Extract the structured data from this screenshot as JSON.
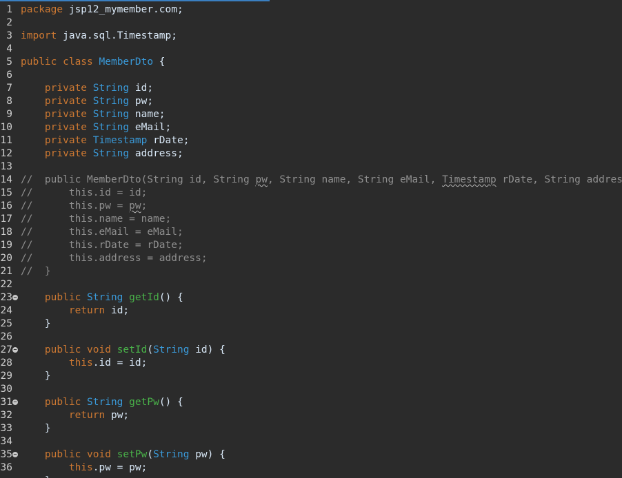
{
  "editor": {
    "colors": {
      "background": "#2b2b2b",
      "keyword": "#cc7832",
      "type": "#3a9ad9",
      "method": "#49b249",
      "plain": "#d9e8f7",
      "comment": "#8f8f8f",
      "accent": "#3a7fc1"
    },
    "fold_icon": "minus-circle-icon",
    "lines": [
      {
        "num": "1",
        "parts": [
          {
            "k": "kw",
            "t": "package"
          },
          {
            "k": "plain",
            "t": " jsp12_mymember.com;"
          }
        ]
      },
      {
        "num": "2",
        "parts": []
      },
      {
        "num": "3",
        "parts": [
          {
            "k": "kw",
            "t": "import"
          },
          {
            "k": "plain",
            "t": " java.sql.Timestamp;"
          }
        ]
      },
      {
        "num": "4",
        "parts": []
      },
      {
        "num": "5",
        "parts": [
          {
            "k": "kw",
            "t": "public class "
          },
          {
            "k": "ty",
            "t": "MemberDto"
          },
          {
            "k": "plain",
            "t": " {"
          }
        ]
      },
      {
        "num": "6",
        "parts": []
      },
      {
        "num": "7",
        "parts": [
          {
            "k": "plain",
            "t": "    "
          },
          {
            "k": "kw",
            "t": "private "
          },
          {
            "k": "ty",
            "t": "String"
          },
          {
            "k": "plain",
            "t": " id;"
          }
        ]
      },
      {
        "num": "8",
        "parts": [
          {
            "k": "plain",
            "t": "    "
          },
          {
            "k": "kw",
            "t": "private "
          },
          {
            "k": "ty",
            "t": "String"
          },
          {
            "k": "plain",
            "t": " pw;"
          }
        ]
      },
      {
        "num": "9",
        "parts": [
          {
            "k": "plain",
            "t": "    "
          },
          {
            "k": "kw",
            "t": "private "
          },
          {
            "k": "ty",
            "t": "String"
          },
          {
            "k": "plain",
            "t": " name;"
          }
        ]
      },
      {
        "num": "10",
        "parts": [
          {
            "k": "plain",
            "t": "    "
          },
          {
            "k": "kw",
            "t": "private "
          },
          {
            "k": "ty",
            "t": "String"
          },
          {
            "k": "plain",
            "t": " eMail;"
          }
        ]
      },
      {
        "num": "11",
        "parts": [
          {
            "k": "plain",
            "t": "    "
          },
          {
            "k": "kw",
            "t": "private "
          },
          {
            "k": "ty",
            "t": "Timestamp"
          },
          {
            "k": "plain",
            "t": " rDate;"
          }
        ]
      },
      {
        "num": "12",
        "parts": [
          {
            "k": "plain",
            "t": "    "
          },
          {
            "k": "kw",
            "t": "private "
          },
          {
            "k": "ty",
            "t": "String"
          },
          {
            "k": "plain",
            "t": " address;"
          }
        ]
      },
      {
        "num": "13",
        "parts": []
      },
      {
        "num": "14",
        "parts": [
          {
            "k": "cm",
            "t": "//  public MemberDto(String id, String "
          },
          {
            "k": "cm sq",
            "t": "pw"
          },
          {
            "k": "cm",
            "t": ", String name, String eMail, "
          },
          {
            "k": "cm sq",
            "t": "Timestamp"
          },
          {
            "k": "cm",
            "t": " rDate, String address) {"
          }
        ]
      },
      {
        "num": "15",
        "parts": [
          {
            "k": "cm",
            "t": "//      this.id = id;"
          }
        ]
      },
      {
        "num": "16",
        "parts": [
          {
            "k": "cm",
            "t": "//      this.pw = "
          },
          {
            "k": "cm sq",
            "t": "pw"
          },
          {
            "k": "cm",
            "t": ";"
          }
        ]
      },
      {
        "num": "17",
        "parts": [
          {
            "k": "cm",
            "t": "//      this.name = name;"
          }
        ]
      },
      {
        "num": "18",
        "parts": [
          {
            "k": "cm",
            "t": "//      this.eMail = eMail;"
          }
        ]
      },
      {
        "num": "19",
        "parts": [
          {
            "k": "cm",
            "t": "//      this.rDate = rDate;"
          }
        ]
      },
      {
        "num": "20",
        "parts": [
          {
            "k": "cm",
            "t": "//      this.address = address;"
          }
        ]
      },
      {
        "num": "21",
        "parts": [
          {
            "k": "cm",
            "t": "//  }"
          }
        ]
      },
      {
        "num": "22",
        "parts": []
      },
      {
        "num": "23",
        "fold": true,
        "parts": [
          {
            "k": "plain",
            "t": "    "
          },
          {
            "k": "kw",
            "t": "public "
          },
          {
            "k": "ty",
            "t": "String"
          },
          {
            "k": "plain",
            "t": " "
          },
          {
            "k": "fn",
            "t": "getId"
          },
          {
            "k": "plain",
            "t": "() {"
          }
        ]
      },
      {
        "num": "24",
        "parts": [
          {
            "k": "plain",
            "t": "        "
          },
          {
            "k": "kw",
            "t": "return"
          },
          {
            "k": "plain",
            "t": " id;"
          }
        ]
      },
      {
        "num": "25",
        "parts": [
          {
            "k": "plain",
            "t": "    }"
          }
        ]
      },
      {
        "num": "26",
        "parts": []
      },
      {
        "num": "27",
        "fold": true,
        "parts": [
          {
            "k": "plain",
            "t": "    "
          },
          {
            "k": "kw",
            "t": "public void "
          },
          {
            "k": "fn",
            "t": "setId"
          },
          {
            "k": "plain",
            "t": "("
          },
          {
            "k": "ty",
            "t": "String"
          },
          {
            "k": "plain",
            "t": " id) {"
          }
        ]
      },
      {
        "num": "28",
        "parts": [
          {
            "k": "plain",
            "t": "        "
          },
          {
            "k": "kw",
            "t": "this"
          },
          {
            "k": "plain",
            "t": ".id = id;"
          }
        ]
      },
      {
        "num": "29",
        "parts": [
          {
            "k": "plain",
            "t": "    }"
          }
        ]
      },
      {
        "num": "30",
        "parts": []
      },
      {
        "num": "31",
        "fold": true,
        "parts": [
          {
            "k": "plain",
            "t": "    "
          },
          {
            "k": "kw",
            "t": "public "
          },
          {
            "k": "ty",
            "t": "String"
          },
          {
            "k": "plain",
            "t": " "
          },
          {
            "k": "fn",
            "t": "getPw"
          },
          {
            "k": "plain",
            "t": "() {"
          }
        ]
      },
      {
        "num": "32",
        "parts": [
          {
            "k": "plain",
            "t": "        "
          },
          {
            "k": "kw",
            "t": "return"
          },
          {
            "k": "plain",
            "t": " pw;"
          }
        ]
      },
      {
        "num": "33",
        "parts": [
          {
            "k": "plain",
            "t": "    }"
          }
        ]
      },
      {
        "num": "34",
        "parts": []
      },
      {
        "num": "35",
        "fold": true,
        "parts": [
          {
            "k": "plain",
            "t": "    "
          },
          {
            "k": "kw",
            "t": "public void "
          },
          {
            "k": "fn",
            "t": "setPw"
          },
          {
            "k": "plain",
            "t": "("
          },
          {
            "k": "ty",
            "t": "String"
          },
          {
            "k": "plain",
            "t": " pw) {"
          }
        ]
      },
      {
        "num": "36",
        "parts": [
          {
            "k": "plain",
            "t": "        "
          },
          {
            "k": "kw",
            "t": "this"
          },
          {
            "k": "plain",
            "t": ".pw = pw;"
          }
        ]
      },
      {
        "num": "",
        "parts": [
          {
            "k": "plain",
            "t": "    }"
          }
        ]
      }
    ]
  }
}
